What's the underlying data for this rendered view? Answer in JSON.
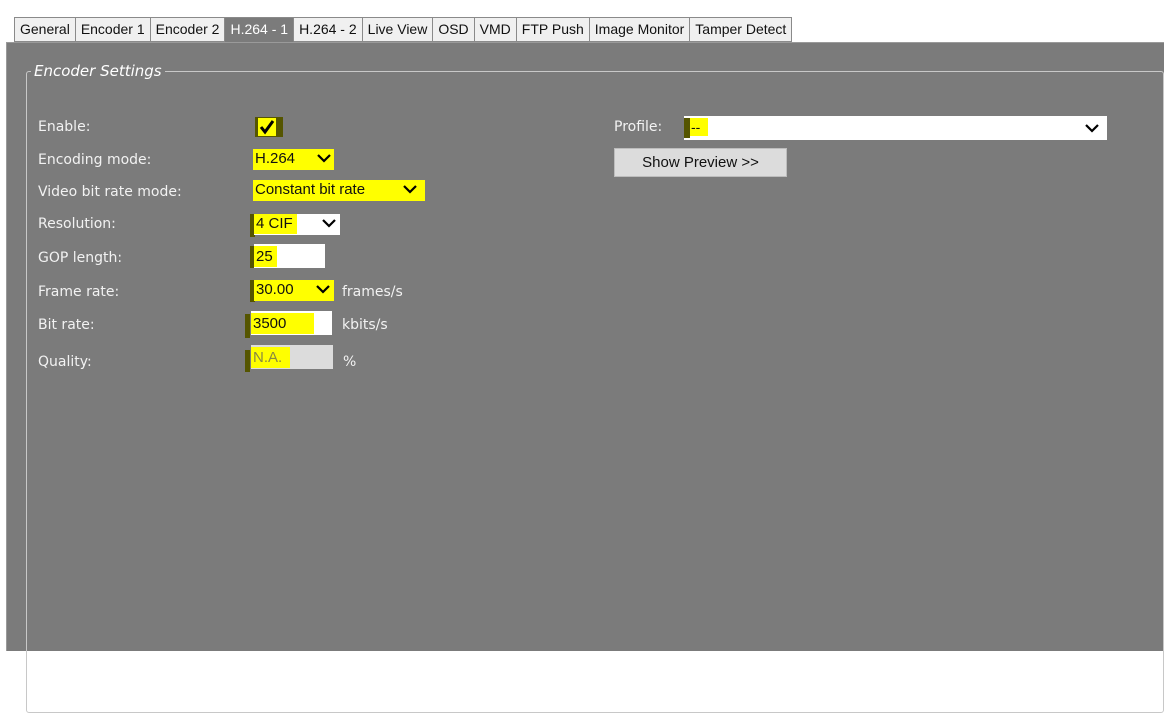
{
  "tabs": [
    "General",
    "Encoder 1",
    "Encoder 2",
    "H.264 - 1",
    "H.264 - 2",
    "Live View",
    "OSD",
    "VMD",
    "FTP Push",
    "Image Monitor",
    "Tamper Detect"
  ],
  "active_tab": "H.264 - 1",
  "section_title": "Encoder Settings",
  "labels": {
    "enable": "Enable:",
    "encoding_mode": "Encoding mode:",
    "video_bit_rate_mode": "Video bit rate mode:",
    "resolution": "Resolution:",
    "gop_length": "GOP length:",
    "frame_rate": "Frame rate:",
    "bit_rate": "Bit rate:",
    "quality": "Quality:",
    "profile": "Profile:"
  },
  "values": {
    "enable_checked": true,
    "encoding_mode": "H.264",
    "video_bit_rate_mode": "Constant bit rate",
    "resolution": "4 CIF",
    "gop_length": "25",
    "frame_rate": "30.00",
    "bit_rate": "3500",
    "quality": "N.A.",
    "profile": "--"
  },
  "units": {
    "frame_rate": "frames/s",
    "bit_rate": "kbits/s",
    "quality": "%"
  },
  "buttons": {
    "show_preview": "Show Preview >>"
  },
  "icons": {
    "dropdown": "chevron-down-icon",
    "checkbox": "checkmark-icon"
  },
  "colors": {
    "panel_bg": "#7b7b7b",
    "highlight": "#ffff00"
  }
}
